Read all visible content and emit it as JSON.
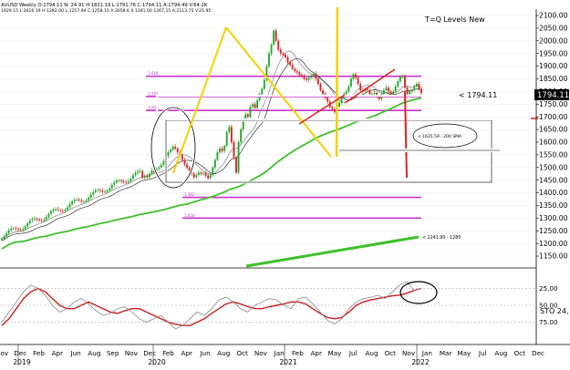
{
  "header": {
    "line1": "AUUSD Weekly O:1794.11 N: 24.91 H:1821.19 L:1791.76 C:1794.11 A:1794.49 V:64.2K",
    "line2": "1929.15 L:2616.19 H:1282.00 L:1257.94 C:1258.15 A:3058.K 0 1281.00 1267.15 A:2113.75 V:25.95",
    "overlay_title": "T=Q Levels New"
  },
  "annotations": {
    "price_tag": "< 1794.11",
    "sma_label": "< 1635.59 - 200 SMA",
    "trend_label": "< 1241.90 - 1280",
    "sto_label": "STO 24,"
  },
  "colors": {
    "up_candle": "#21a629",
    "down_candle": "#d42222",
    "magenta_levels": "#cc33cc",
    "green_ma": "#3fbf2a",
    "yellow_lines": "#f5d000",
    "red_lines": "#e02020",
    "osc_red": "#c81e1e",
    "osc_grey": "#888888"
  },
  "chart_data": [
    {
      "type": "candlestick",
      "title": "",
      "ylim": [
        1100,
        2100
      ],
      "y_ticks": [
        1150,
        1200,
        1250,
        1300,
        1350,
        1400,
        1450,
        1500,
        1550,
        1600,
        1650,
        1700,
        1750,
        1800,
        1850,
        1900,
        1950,
        2000,
        2050,
        2100
      ],
      "y_tick_labels": [
        "1150.00",
        "1200.00",
        "1250.00",
        "1300.00",
        "1350.00",
        "1400.00",
        "1450.00",
        "1500.00",
        "1550.00",
        "1600.00",
        "1650.00",
        "1700.00",
        "1750.00",
        "1800.00",
        "1850.00",
        "1900.00",
        "1950.00",
        "2000.00",
        "2050.00",
        "2100.00"
      ],
      "last_price": "1794.11",
      "x_labels": [
        "Nov",
        "Dec",
        "Feb",
        "Apr",
        "Jun",
        "Aug",
        "Sep",
        "Nov",
        "Dec",
        "Feb",
        "Apr",
        "Jun",
        "Aug",
        "Oct",
        "Nov",
        "Jan",
        "Feb",
        "Apr",
        "May",
        "Jul",
        "Aug",
        "Oct",
        "Nov",
        "Jan",
        "Mar",
        "May",
        "Jul",
        "Aug",
        "Oct",
        "Dec"
      ],
      "year_labels": [
        "2019",
        "2020",
        "2021",
        "2022"
      ],
      "levels": [
        {
          "label": "1.618",
          "value": 1860
        },
        {
          "label": "1.382",
          "value": 1780
        },
        {
          "label": "1.000",
          "value": 1725
        },
        {
          "label": "1.382",
          "value": 1382
        },
        {
          "label": "1.618",
          "value": 1300
        }
      ],
      "weekly_close": [
        1460,
        1468,
        1462,
        1475,
        1488,
        1480,
        1495,
        1500,
        1510,
        1525,
        1545,
        1560,
        1570,
        1582,
        1575,
        1560,
        1548,
        1530,
        1512,
        1500,
        1488,
        1475,
        1462,
        1470,
        1480,
        1475,
        1478,
        1468,
        1458,
        1470,
        1500,
        1530,
        1560,
        1575,
        1565,
        1585,
        1640,
        1660,
        1600,
        1540,
        1480,
        1600,
        1650,
        1690,
        1710,
        1700,
        1740,
        1750,
        1735,
        1765,
        1790,
        1810,
        1845,
        1900,
        1950,
        1985,
        2040,
        2000,
        1965,
        1950,
        1945,
        1935,
        1915,
        1905,
        1890,
        1880,
        1875,
        1865,
        1860,
        1850,
        1845,
        1855,
        1860,
        1870,
        1850,
        1830,
        1805,
        1790,
        1775,
        1760,
        1738,
        1730,
        1720,
        1740,
        1755,
        1775,
        1790,
        1800,
        1820,
        1850,
        1868,
        1855,
        1830,
        1805,
        1800,
        1810,
        1805,
        1790,
        1790,
        1795,
        1780,
        1770,
        1790,
        1805,
        1815,
        1800,
        1790,
        1800,
        1820,
        1840,
        1860,
        1860,
        1815,
        1790,
        1800,
        1805,
        1820,
        1830,
        1810,
        1794
      ]
    },
    {
      "type": "line",
      "title": "",
      "ylim": [
        0,
        100
      ],
      "y_tick_labels": [
        "25.00",
        "50.00",
        "75.00"
      ],
      "series": [
        {
          "values": [
            80,
            70,
            55,
            40,
            30,
            25,
            30,
            40,
            50,
            55,
            55,
            50,
            45,
            50,
            55,
            60,
            62,
            58,
            55,
            55,
            60,
            65,
            70,
            75,
            78,
            80,
            80,
            75,
            70,
            62,
            55,
            48,
            45,
            48,
            52,
            55,
            55,
            52,
            50,
            48,
            45,
            45,
            48,
            55,
            62,
            68,
            70,
            68,
            60,
            50,
            45,
            42,
            40,
            38,
            36,
            35,
            32,
            28,
            25
          ]
        },
        {
          "values": [
            75,
            60,
            45,
            30,
            20,
            25,
            35,
            50,
            60,
            55,
            45,
            40,
            48,
            58,
            65,
            62,
            55,
            52,
            60,
            70,
            75,
            70,
            65,
            75,
            85,
            80,
            70,
            60,
            65,
            55,
            42,
            38,
            45,
            55,
            60,
            50,
            45,
            40,
            42,
            50,
            55,
            40,
            38,
            48,
            60,
            72,
            78,
            70,
            55,
            45,
            40,
            38,
            35,
            40,
            30,
            20,
            15,
            28,
            25
          ]
        }
      ]
    }
  ]
}
